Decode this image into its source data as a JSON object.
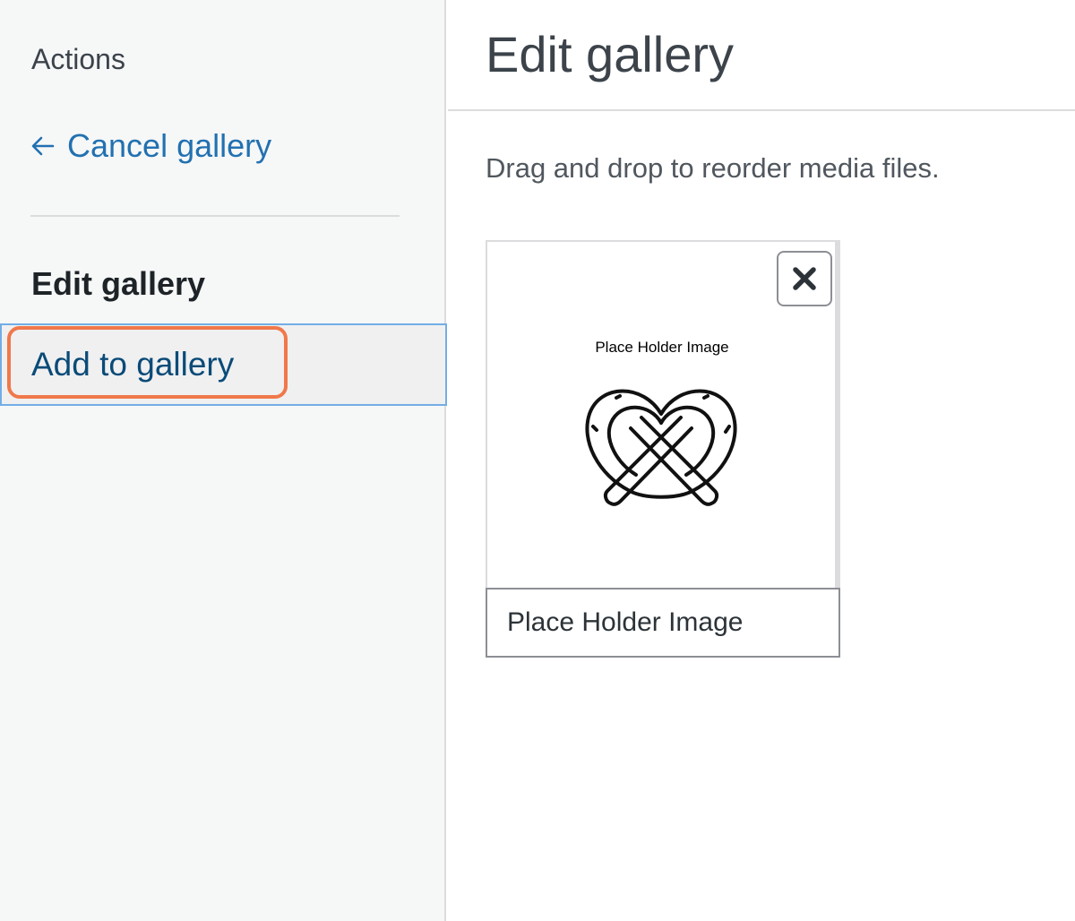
{
  "sidebar": {
    "heading": "Actions",
    "cancel_label": "Cancel gallery",
    "section_title": "Edit gallery",
    "add_label": "Add to gallery"
  },
  "main": {
    "title": "Edit gallery",
    "instructions": "Drag and drop to reorder media files.",
    "attachment": {
      "thumbnail_caption": "Place Holder Image",
      "caption_value": "Place Holder Image"
    }
  },
  "colors": {
    "link": "#2271b1",
    "selected_border": "#72aee6",
    "highlight_ring": "#f0784a"
  },
  "icons": [
    "arrow-left-icon",
    "pretzel-image",
    "close-icon"
  ]
}
